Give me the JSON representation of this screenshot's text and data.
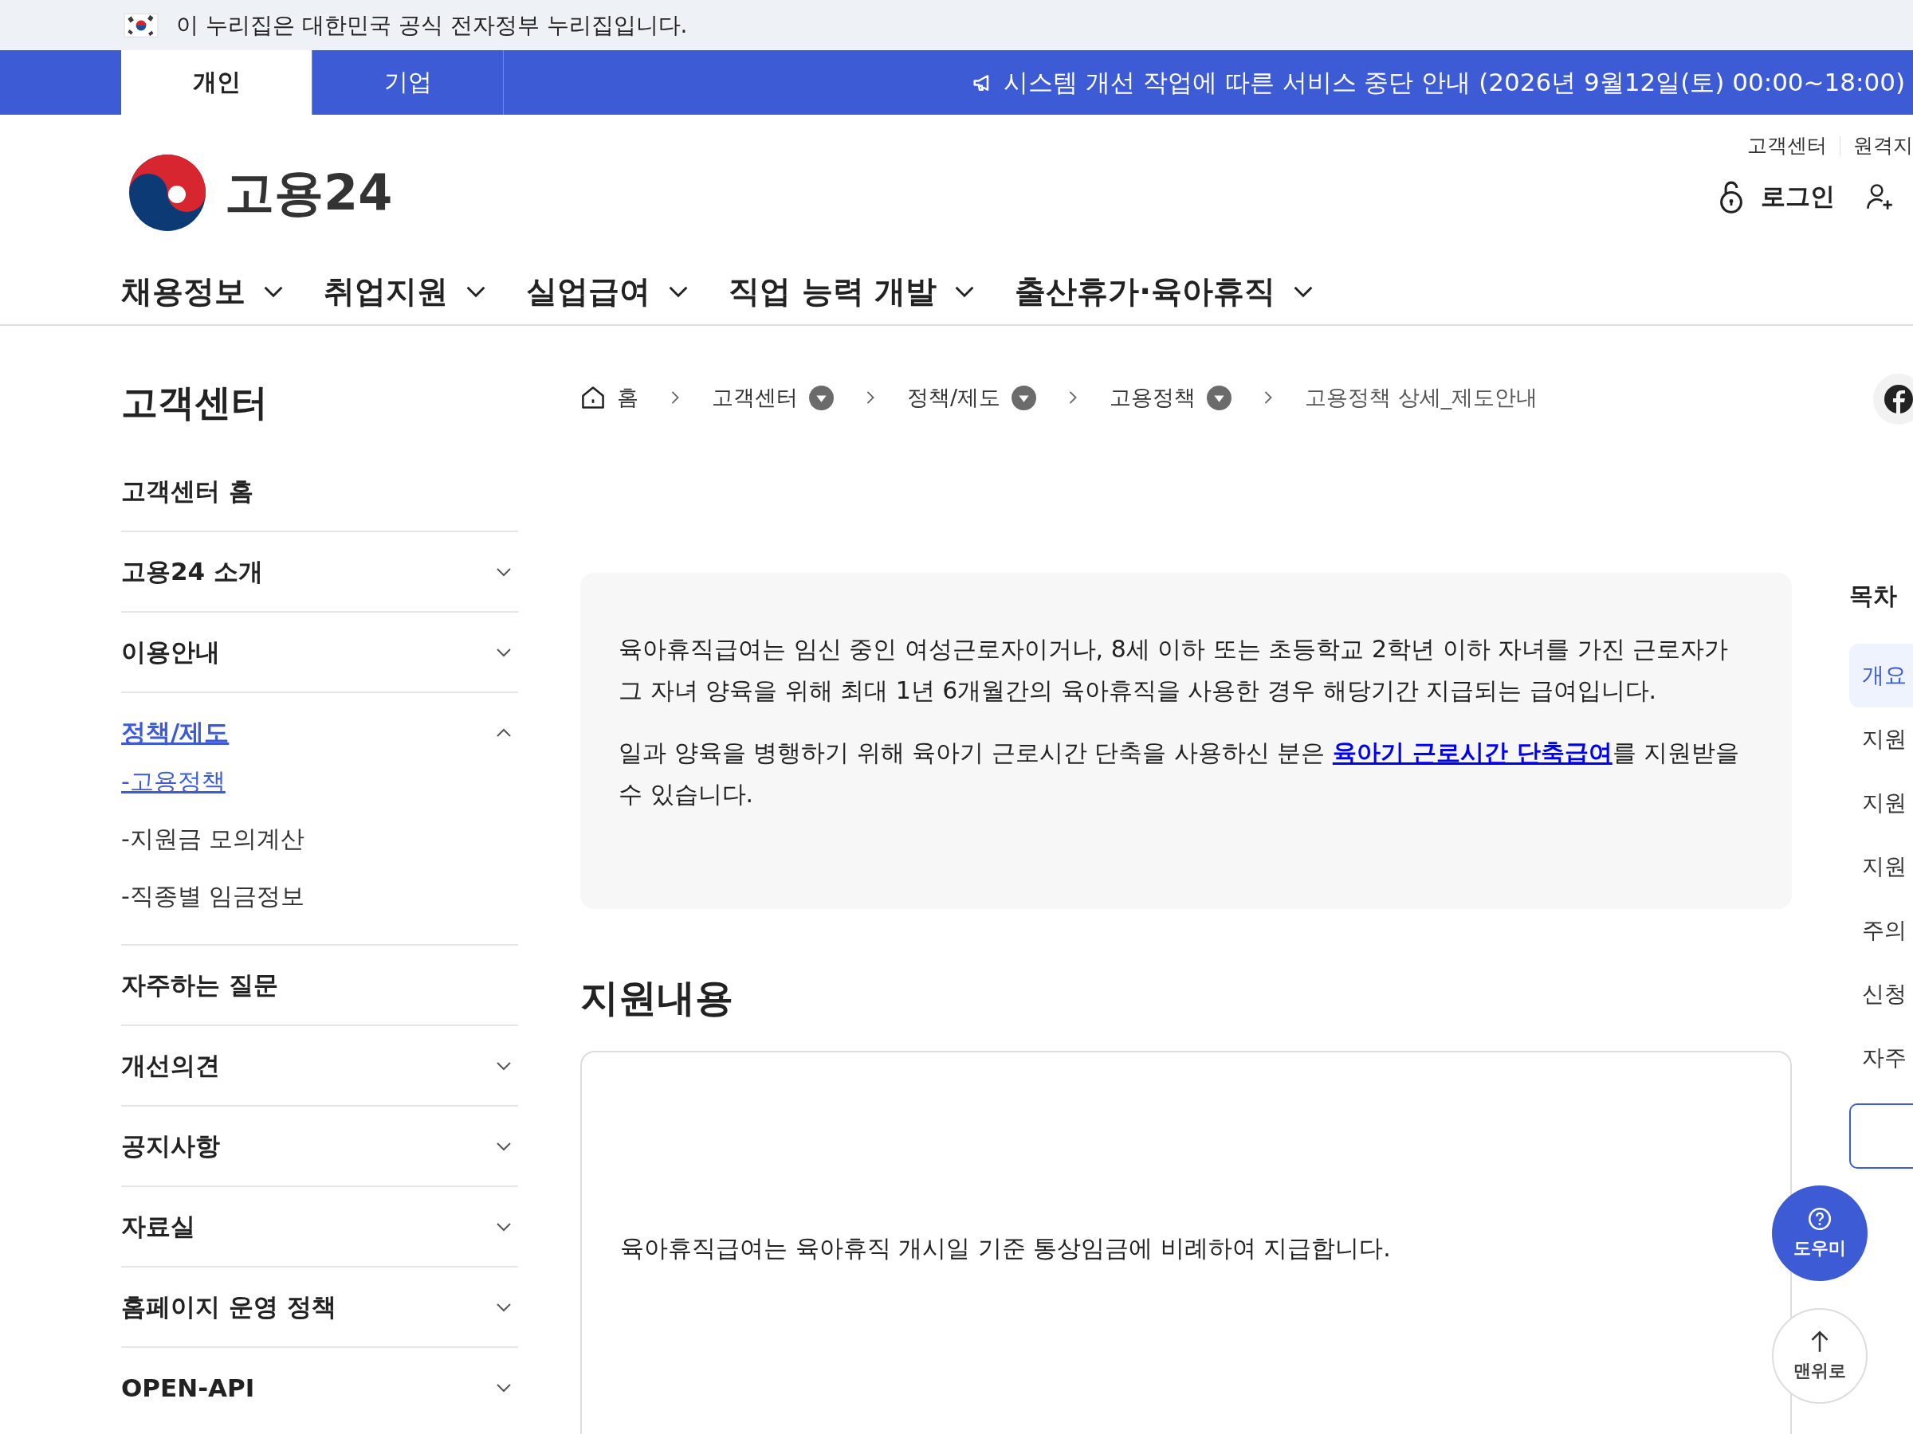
{
  "gov_banner": {
    "text": "이 누리집은 대한민국 공식 전자정부 누리집입니다."
  },
  "audience_tabs": [
    {
      "label": "개인",
      "selected": true
    },
    {
      "label": "기업",
      "selected": false
    }
  ],
  "notice": {
    "text": "시스템 개선 작업에 따른 서비스 중단 안내 (2026년 9월12일(토) 00:00~18:00)"
  },
  "header": {
    "logo": "고용24",
    "utility_links": [
      "고객센터",
      "원격지"
    ],
    "login": "로그인"
  },
  "main_nav": [
    "채용정보",
    "취업지원",
    "실업급여",
    "직업 능력 개발",
    "출산휴가·육아휴직"
  ],
  "sidebar": {
    "title": "고객센터",
    "items": [
      {
        "label": "고객센터 홈",
        "kind": "link"
      },
      {
        "label": "고용24 소개",
        "kind": "group",
        "expanded": false,
        "selected": false
      },
      {
        "label": "이용안내",
        "kind": "group",
        "expanded": false,
        "selected": false
      },
      {
        "label": "정책/제도",
        "kind": "group",
        "expanded": true,
        "selected": true,
        "children": [
          {
            "label": "-고용정책",
            "selected": true
          },
          {
            "label": "-지원금 모의계산",
            "selected": false
          },
          {
            "label": "-직종별 임금정보",
            "selected": false
          }
        ]
      },
      {
        "label": "자주하는 질문",
        "kind": "link"
      },
      {
        "label": "개선의견",
        "kind": "group",
        "expanded": false,
        "selected": false
      },
      {
        "label": "공지사항",
        "kind": "group",
        "expanded": false,
        "selected": false
      },
      {
        "label": "자료실",
        "kind": "group",
        "expanded": false,
        "selected": false
      },
      {
        "label": "홈페이지 운영 정책",
        "kind": "group",
        "expanded": false,
        "selected": false
      },
      {
        "label": "OPEN-API",
        "kind": "group",
        "expanded": false,
        "selected": false
      }
    ]
  },
  "breadcrumb": [
    {
      "label": "홈",
      "kind": "home"
    },
    {
      "label": "고객센터",
      "kind": "dropdown"
    },
    {
      "label": "정책/제도",
      "kind": "dropdown"
    },
    {
      "label": "고용정책",
      "kind": "dropdown"
    },
    {
      "label": "고용정책 상세_제도안내",
      "kind": "current"
    }
  ],
  "intro": {
    "paragraphs": [
      [
        {
          "text": "육아휴직급여는 임신 중인 여성근로자이거나, 8세 이하 또는 초등학교 2학년 이하 자녀를 가진 근로자가 그 자녀 양육을 위해 최대 1년 6개월간의 육아휴직을 사용한 경우 해당기간 지급되는 급여입니다.",
          "kind": "text"
        }
      ],
      [
        {
          "text": "일과 양육을 병행하기 위해 육아기 근로시간 단축을 사용하신 분은 ",
          "kind": "text"
        },
        {
          "text": "육아기 근로시간 단축급여",
          "kind": "link"
        },
        {
          "text": "를 지원받을 수 있습니다.",
          "kind": "text"
        }
      ]
    ]
  },
  "section": {
    "title": "지원내용",
    "text": "육아휴직급여는 육아휴직 개시일 기준 통상임금에 비례하여 지급합니다."
  },
  "toc": {
    "title": "목차",
    "items": [
      {
        "label": "개요",
        "selected": true
      },
      {
        "label": "지원",
        "selected": false
      },
      {
        "label": "지원",
        "selected": false
      },
      {
        "label": "지원",
        "selected": false
      },
      {
        "label": "주의",
        "selected": false
      },
      {
        "label": "신청",
        "selected": false
      },
      {
        "label": "자주",
        "selected": false
      }
    ]
  },
  "floating": {
    "help": "도우미",
    "top": "맨위로"
  }
}
